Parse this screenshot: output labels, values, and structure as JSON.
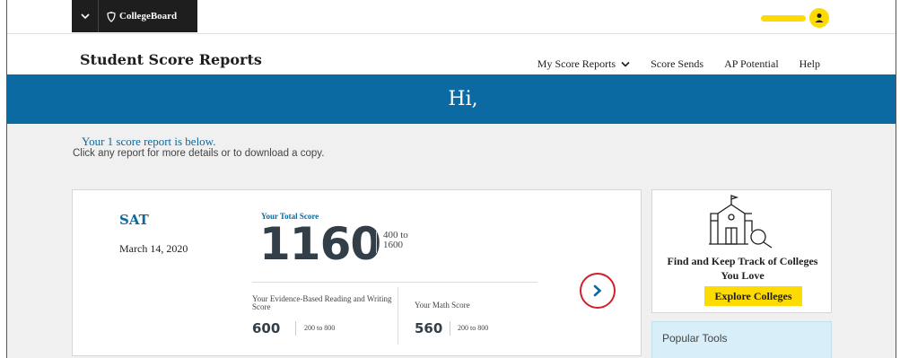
{
  "brand": {
    "name": "CollegeBoard",
    "yellow": "#fedb00",
    "blue": "#0a6aa1",
    "dark": "#1e1e1e",
    "alert_red": "#d0202a"
  },
  "header": {
    "title": "Student Score Reports",
    "nav": [
      {
        "label": "My Score Reports",
        "has_dropdown": true
      },
      {
        "label": "Score Sends"
      },
      {
        "label": "AP Potential"
      },
      {
        "label": "Help"
      }
    ]
  },
  "banner": {
    "greeting": "Hi,"
  },
  "intro": {
    "line1": "Your 1 score report is below.",
    "line2": "Click any report for more details or to download a copy."
  },
  "score_card": {
    "test": "SAT",
    "date": "March 14, 2020",
    "total_label": "Your Total Score",
    "total_score": "1160",
    "total_range": "400 to 1600",
    "sections": [
      {
        "label": "Your Evidence-Based Reading and Writing Score",
        "score": "600",
        "range": "200 to 800"
      },
      {
        "label": "Your Math Score",
        "score": "560",
        "range": "200 to 800"
      }
    ],
    "details_icon": "chevron-right-icon"
  },
  "sidebar": {
    "explore": {
      "icon": "college-search-icon",
      "title": "Find and Keep Track of Colleges You Love",
      "button": "Explore Colleges"
    },
    "tools": {
      "title": "Popular Tools"
    }
  }
}
